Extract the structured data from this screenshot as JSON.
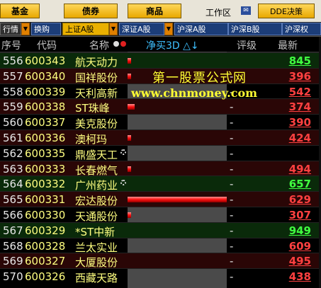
{
  "topbar": {
    "btn_fund": "基金",
    "btn_bond": "债券",
    "btn_commodity": "商品",
    "workspace": "工作区",
    "btn_dde": "DDE决策"
  },
  "tabs": [
    {
      "label": "行情"
    },
    {
      "label": "换购"
    },
    {
      "label": "上证A股"
    },
    {
      "label": "深证A股"
    },
    {
      "label": "沪深A股"
    },
    {
      "label": "沪深B股"
    },
    {
      "label": "沪深权"
    }
  ],
  "columns": {
    "seq": "序号",
    "code": "代码",
    "name": "名称",
    "net_buy": "净买3D △↓",
    "rating": "评级",
    "latest": "最新"
  },
  "watermark": {
    "line1": "第一股票公式网",
    "line2": "www.chnmoney.com"
  },
  "colors": {
    "up": "#ff4040",
    "up_green": "#40ff40",
    "accent": "#e9b000"
  },
  "rows": [
    {
      "seq": "556",
      "code": "600343",
      "name": "航天动力",
      "rating": "",
      "latest": "845",
      "latest_color": "green",
      "bar": 0.02
    },
    {
      "seq": "557",
      "code": "600340",
      "name": "国祥股份",
      "rating": "-",
      "latest": "396",
      "latest_color": "red",
      "bar": 0.02
    },
    {
      "seq": "558",
      "code": "600339",
      "name": "天利高新",
      "rating": "-",
      "latest": "542",
      "latest_color": "red",
      "bar": 0
    },
    {
      "seq": "559",
      "code": "600338",
      "name": "ST珠峰",
      "rating": "-",
      "latest": "374",
      "latest_color": "red",
      "bar": 0.07
    },
    {
      "seq": "560",
      "code": "600337",
      "name": "美克股份",
      "rating": "-",
      "latest": "390",
      "latest_color": "red",
      "bar": 0
    },
    {
      "seq": "561",
      "code": "600336",
      "name": "澳柯玛",
      "rating": "-",
      "latest": "424",
      "latest_color": "red",
      "bar": 0.02
    },
    {
      "seq": "562",
      "code": "600335",
      "name": "鼎盛天工",
      "rating": "-",
      "latest": "",
      "latest_color": "red",
      "bar": 0,
      "gear": true
    },
    {
      "seq": "563",
      "code": "600333",
      "name": "长春燃气",
      "rating": "-",
      "latest": "494",
      "latest_color": "red",
      "bar": 0.02
    },
    {
      "seq": "564",
      "code": "600332",
      "name": "广州药业",
      "rating": "-",
      "latest": "657",
      "latest_color": "green",
      "bar": 0,
      "gear": true
    },
    {
      "seq": "565",
      "code": "600331",
      "name": "宏达股份",
      "rating": "-",
      "latest": "629",
      "latest_color": "red",
      "bar": 1.0
    },
    {
      "seq": "566",
      "code": "600330",
      "name": "天通股份",
      "rating": "-",
      "latest": "307",
      "latest_color": "red",
      "bar": 0.02
    },
    {
      "seq": "567",
      "code": "600329",
      "name": "*ST中新",
      "rating": "-",
      "latest": "949",
      "latest_color": "green",
      "bar": 0
    },
    {
      "seq": "568",
      "code": "600328",
      "name": "兰太实业",
      "rating": "-",
      "latest": "609",
      "latest_color": "red",
      "bar": 0
    },
    {
      "seq": "569",
      "code": "600327",
      "name": "大厦股份",
      "rating": "-",
      "latest": "495",
      "latest_color": "red",
      "bar": 0
    },
    {
      "seq": "570",
      "code": "600326",
      "name": "西藏天路",
      "rating": "-",
      "latest": "438",
      "latest_color": "red",
      "bar": 0
    }
  ]
}
